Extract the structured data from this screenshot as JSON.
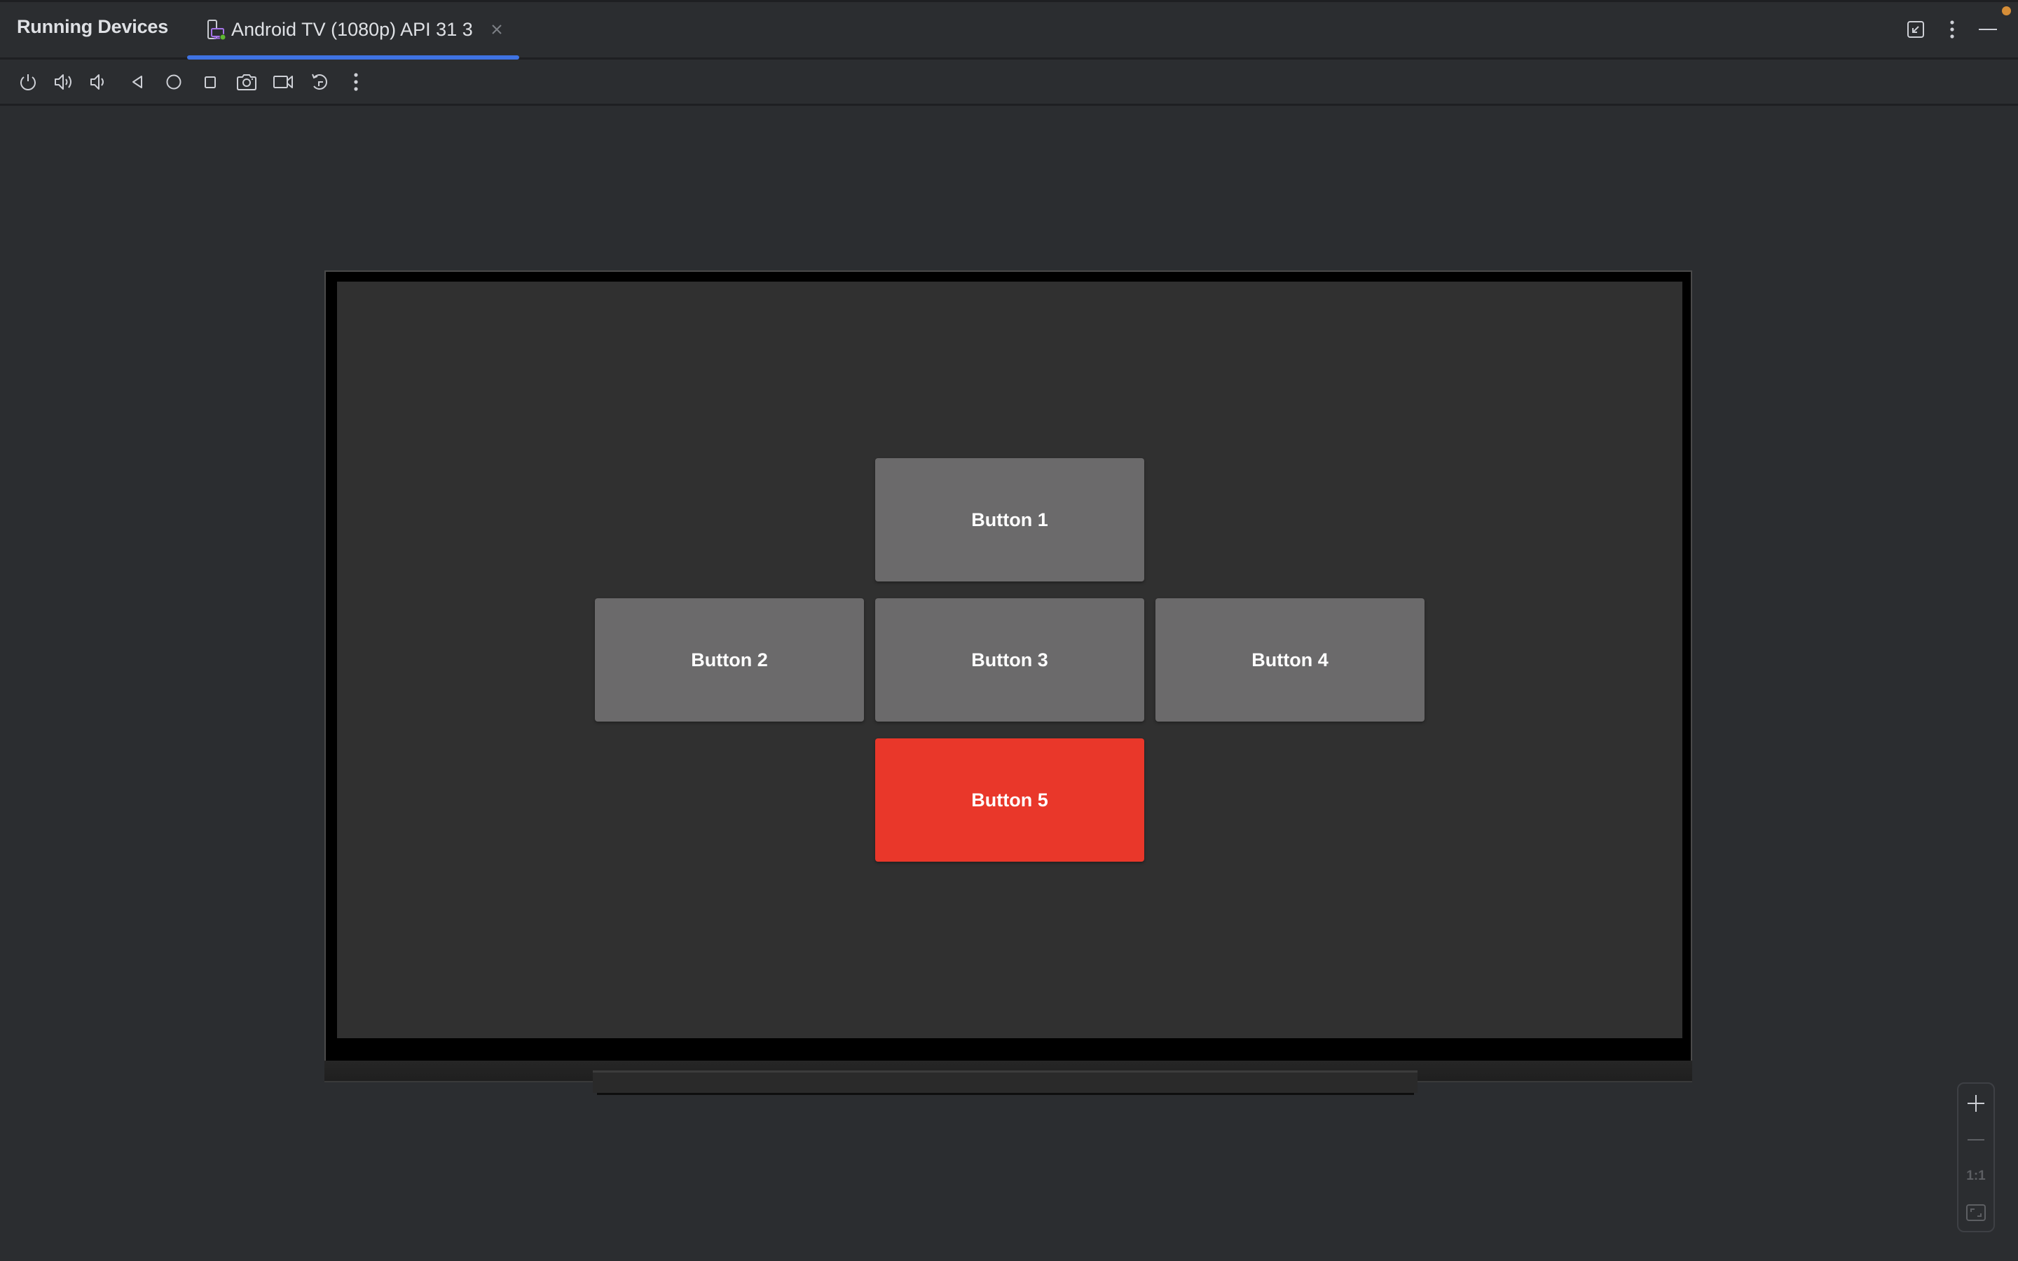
{
  "window": {
    "panel_title": "Running Devices",
    "tabs": [
      {
        "label": "Android TV (1080p) API 31 3",
        "icon": "device-tv-icon",
        "active": true,
        "status": "online"
      }
    ],
    "right_actions": [
      {
        "name": "restore-icon",
        "label": "Restore"
      },
      {
        "name": "more-options-icon",
        "label": "Options"
      },
      {
        "name": "hide-icon",
        "label": "Hide"
      }
    ],
    "notification_dot_color": "#d58d37",
    "accent_color": "#3f73e3"
  },
  "toolbar": {
    "items": [
      {
        "icon": "power-icon",
        "label": "Power"
      },
      {
        "icon": "volume-up-icon",
        "label": "Volume Up"
      },
      {
        "icon": "volume-down-icon",
        "label": "Volume Down"
      },
      {
        "icon": "back-icon",
        "label": "Back"
      },
      {
        "icon": "home-icon",
        "label": "Home"
      },
      {
        "icon": "overview-icon",
        "label": "Overview"
      },
      {
        "icon": "camera-icon",
        "label": "Take Screenshot"
      },
      {
        "icon": "video-icon",
        "label": "Record Screen"
      },
      {
        "icon": "rotate-icon",
        "label": "Rotate"
      },
      {
        "icon": "more-vert-icon",
        "label": "More"
      }
    ]
  },
  "device_screen": {
    "background": "#303030",
    "buttons": [
      {
        "label": "Button 1",
        "color": "#6b6a6b",
        "focused": false
      },
      {
        "label": "Button 2",
        "color": "#6b6a6b",
        "focused": false
      },
      {
        "label": "Button 3",
        "color": "#6b6a6b",
        "focused": false
      },
      {
        "label": "Button 4",
        "color": "#6b6a6b",
        "focused": false
      },
      {
        "label": "Button 5",
        "color": "#e9372a",
        "focused": true
      }
    ]
  },
  "zoom_controls": {
    "zoom_in": "+",
    "zoom_out": "−",
    "actual_size": "1:1",
    "fit": "fit-screen"
  }
}
